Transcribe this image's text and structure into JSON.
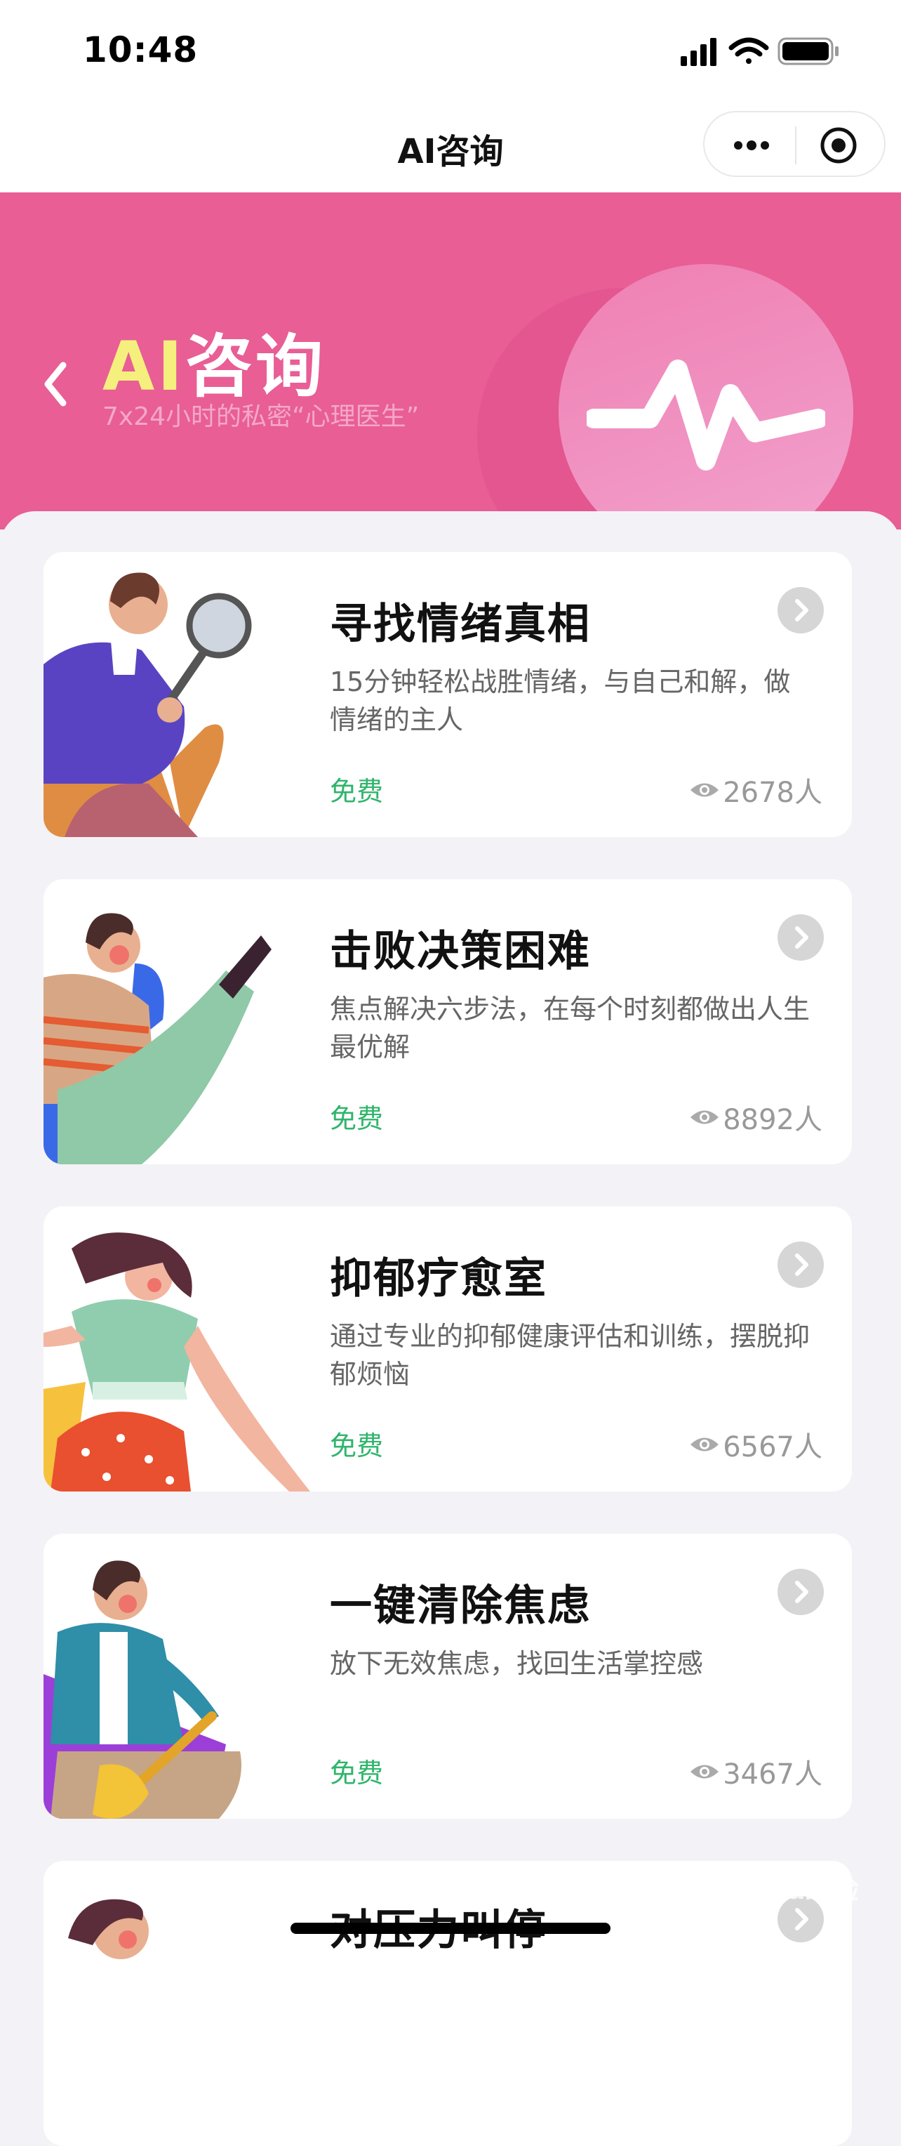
{
  "status_bar": {
    "time": "10:48"
  },
  "navbar": {
    "title": "AI咨询"
  },
  "hero": {
    "title_ai": "AI",
    "title_rest": "咨询",
    "subtitle": "7x24小时的私密“心理医生”"
  },
  "cards": [
    {
      "title": "寻找情绪真相",
      "desc": "15分钟轻松战胜情绪，与自己和解，做情绪的主人",
      "price": "免费",
      "views": "2678人"
    },
    {
      "title": "击败决策困难",
      "desc": "焦点解决六步法，在每个时刻都做出人生最优解",
      "price": "免费",
      "views": "8892人"
    },
    {
      "title": "抑郁疗愈室",
      "desc": "通过专业的抑郁健康评估和训练，摆脱抑郁烦恼",
      "price": "免费",
      "views": "6567人"
    },
    {
      "title": "一键清除焦虑",
      "desc": "放下无效焦虑，找回生活掌控感",
      "price": "免费",
      "views": "3467人"
    },
    {
      "title": "对压力叫停",
      "desc": "",
      "price": "",
      "views": ""
    }
  ],
  "watermark": "Baidu经验",
  "colors": {
    "hero_bg": "#e85e95",
    "accent_green": "#2fb56b",
    "title_yellow": "#f5f07e"
  },
  "icons": [
    "signal-icon",
    "wifi-icon",
    "battery-icon",
    "more-icon",
    "close-target-icon",
    "back-chevron-icon",
    "pulse-icon",
    "eye-icon",
    "chevron-right-icon"
  ]
}
